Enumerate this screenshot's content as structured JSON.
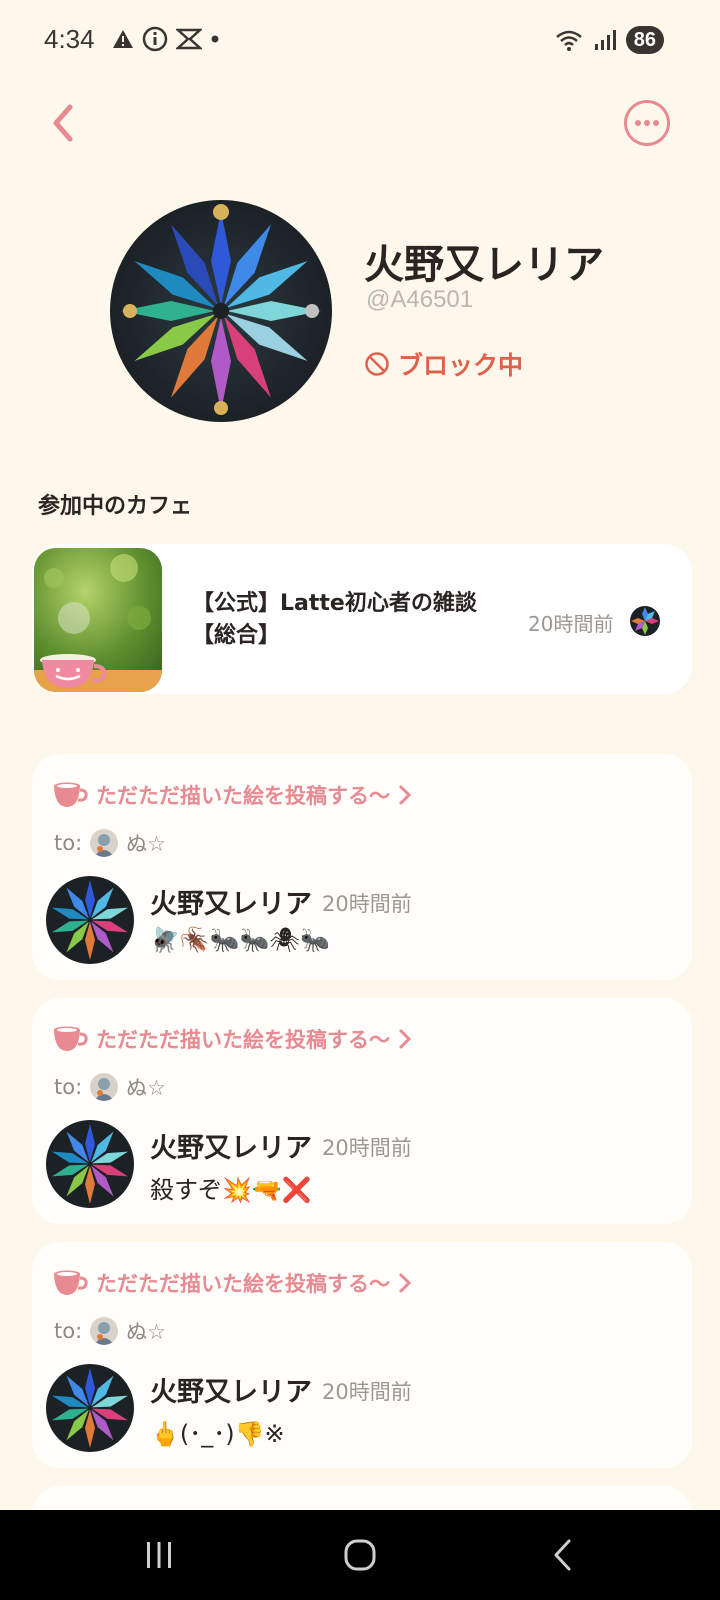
{
  "status_bar": {
    "time": "4:34",
    "battery": "86"
  },
  "profile": {
    "name": "火野又レリア",
    "handle": "@A46501",
    "block_label": "ブロック中"
  },
  "cafes": {
    "section_title": "参加中のカフェ",
    "items": [
      {
        "title": "【公式】Latte初心者の雑談【総合】",
        "time": "20時間前"
      }
    ]
  },
  "posts": [
    {
      "topic": "ただただ描いた絵を投稿する〜",
      "to_prefix": "to:",
      "to_name": "ぬ☆",
      "author": "火野又レリア",
      "time": "20時間前",
      "body": "🪰🪳🐜🐜🕷🐜"
    },
    {
      "topic": "ただただ描いた絵を投稿する〜",
      "to_prefix": "to:",
      "to_name": "ぬ☆",
      "author": "火野又レリア",
      "time": "20時間前",
      "body": "殺すぞ💥🔫❌"
    },
    {
      "topic": "ただただ描いた絵を投稿する〜",
      "to_prefix": "to:",
      "to_name": "ぬ☆",
      "author": "火野又レリア",
      "time": "20時間前",
      "body": "🖕(･_･)👎※"
    }
  ],
  "colors": {
    "background": "#fdf7ec",
    "accent_pink": "#e88a92",
    "block_red": "#e0614a",
    "muted_text": "#9c9793"
  },
  "icons": {
    "back": "chevron-left-icon",
    "more": "more-horizontal-icon",
    "block": "prohibited-icon",
    "topic": "coffee-cup-icon",
    "topic_arrow": "chevron-right-icon"
  }
}
